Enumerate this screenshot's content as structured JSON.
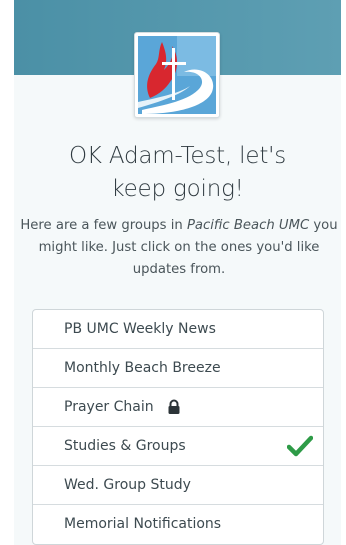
{
  "header": {
    "title_line1": "OK Adam-Test, let's",
    "title_line2": "keep going!",
    "logo_icon": "church-cross-flame-logo"
  },
  "intro": {
    "part1": "Here are a few groups in ",
    "org_name": "Pacific Beach UMC",
    "part2": " you might like. Just click on the ones you'd like updates from."
  },
  "groups": [
    {
      "label": "PB UMC Weekly News",
      "locked": false,
      "selected": false
    },
    {
      "label": "Monthly Beach Breeze",
      "locked": false,
      "selected": false
    },
    {
      "label": "Prayer Chain",
      "locked": true,
      "selected": false
    },
    {
      "label": "Studies & Groups",
      "locked": false,
      "selected": true
    },
    {
      "label": "Wed. Group Study",
      "locked": false,
      "selected": false
    },
    {
      "label": "Memorial Notifications",
      "locked": false,
      "selected": false
    }
  ],
  "colors": {
    "accent_header": "#4b90a6",
    "check_green": "#2e9b47",
    "logo_red": "#d8272f",
    "logo_blue": "#5aa6d8"
  }
}
